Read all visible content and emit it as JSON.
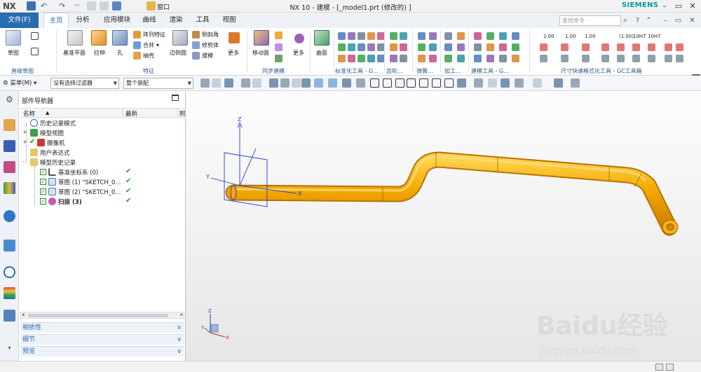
{
  "titlebar": {
    "logo": "NX",
    "window_menu": "窗口",
    "title": "NX 10 - 建模 - [_model1.prt  (修改的) ]",
    "brand": "SIEMENS",
    "brand_color": "#009999"
  },
  "tabs": {
    "file": "文件(F)",
    "items": [
      "主页",
      "分析",
      "应用模块",
      "曲线",
      "渲染",
      "工具",
      "视图"
    ],
    "active": "主页",
    "search_placeholder": "查找命令"
  },
  "ribbon": {
    "groups": {
      "direct_sketch": "直接草图",
      "feature": "特征",
      "sync_model": "同步建模",
      "std_tools": "标准化工具 - G...",
      "gear": "齿轮...",
      "spring": "弹簧...",
      "machining": "加工...",
      "modeling_tools": "建模工具 - G...",
      "dim_tools": "尺寸快速格式化工具 - GC工具箱"
    },
    "buttons": {
      "sketch": "草图",
      "datum_plane": "基准平面",
      "extrude": "拉伸",
      "hole": "孔",
      "pattern_feature": "阵列特征",
      "unite": "合并",
      "shell": "抽壳",
      "edge_blend": "边倒圆",
      "chamfer": "倒斜角",
      "trim_body": "修剪体",
      "draft": "拔模",
      "more1": "更多",
      "move_face": "移动面",
      "more2": "更多",
      "surface": "曲面"
    },
    "dim_labels": [
      "1.00",
      "1.00",
      "1.00",
      "(1.00)",
      "10H7",
      "10H7"
    ]
  },
  "filterbar": {
    "menu": "菜单(M)",
    "type_filter": "没有选择过滤器",
    "scope": "整个装配"
  },
  "navigator": {
    "title": "部件导航器",
    "columns": {
      "name": "名称",
      "latest": "最新",
      "more": "附"
    },
    "rows": [
      {
        "label": "历史记录模式",
        "level": 1,
        "expand": "",
        "checkbox": false,
        "latest": ""
      },
      {
        "label": "模型视图",
        "level": 1,
        "expand": "+",
        "checkbox": false,
        "latest": ""
      },
      {
        "label": "摄像机",
        "level": 1,
        "expand": "+",
        "checkbox": true,
        "latest": ""
      },
      {
        "label": "用户表达式",
        "level": 1,
        "expand": "",
        "checkbox": false,
        "latest": ""
      },
      {
        "label": "模型历史记录",
        "level": 1,
        "expand": "-",
        "checkbox": false,
        "latest": ""
      },
      {
        "label": "基准坐标系 (0)",
        "level": 2,
        "expand": "",
        "checkbox": true,
        "latest": "✔"
      },
      {
        "label": "草图 (1) \"SKETCH_0...",
        "level": 2,
        "expand": "",
        "checkbox": true,
        "latest": "✔"
      },
      {
        "label": "草图 (2) \"SKETCH_0...",
        "level": 2,
        "expand": "",
        "checkbox": true,
        "latest": "✔"
      },
      {
        "label": "扫掠 (3)",
        "level": 2,
        "expand": "",
        "checkbox": true,
        "latest": "✔"
      }
    ],
    "sections": [
      "相依性",
      "细节",
      "预览"
    ]
  },
  "graphics": {
    "axis_x": "X",
    "axis_y": "Y",
    "axis_z": "Z",
    "pipe_color": "#f2a200",
    "watermark_brand": "Baidu经验",
    "watermark_url": "jingyan.baidu.com"
  }
}
